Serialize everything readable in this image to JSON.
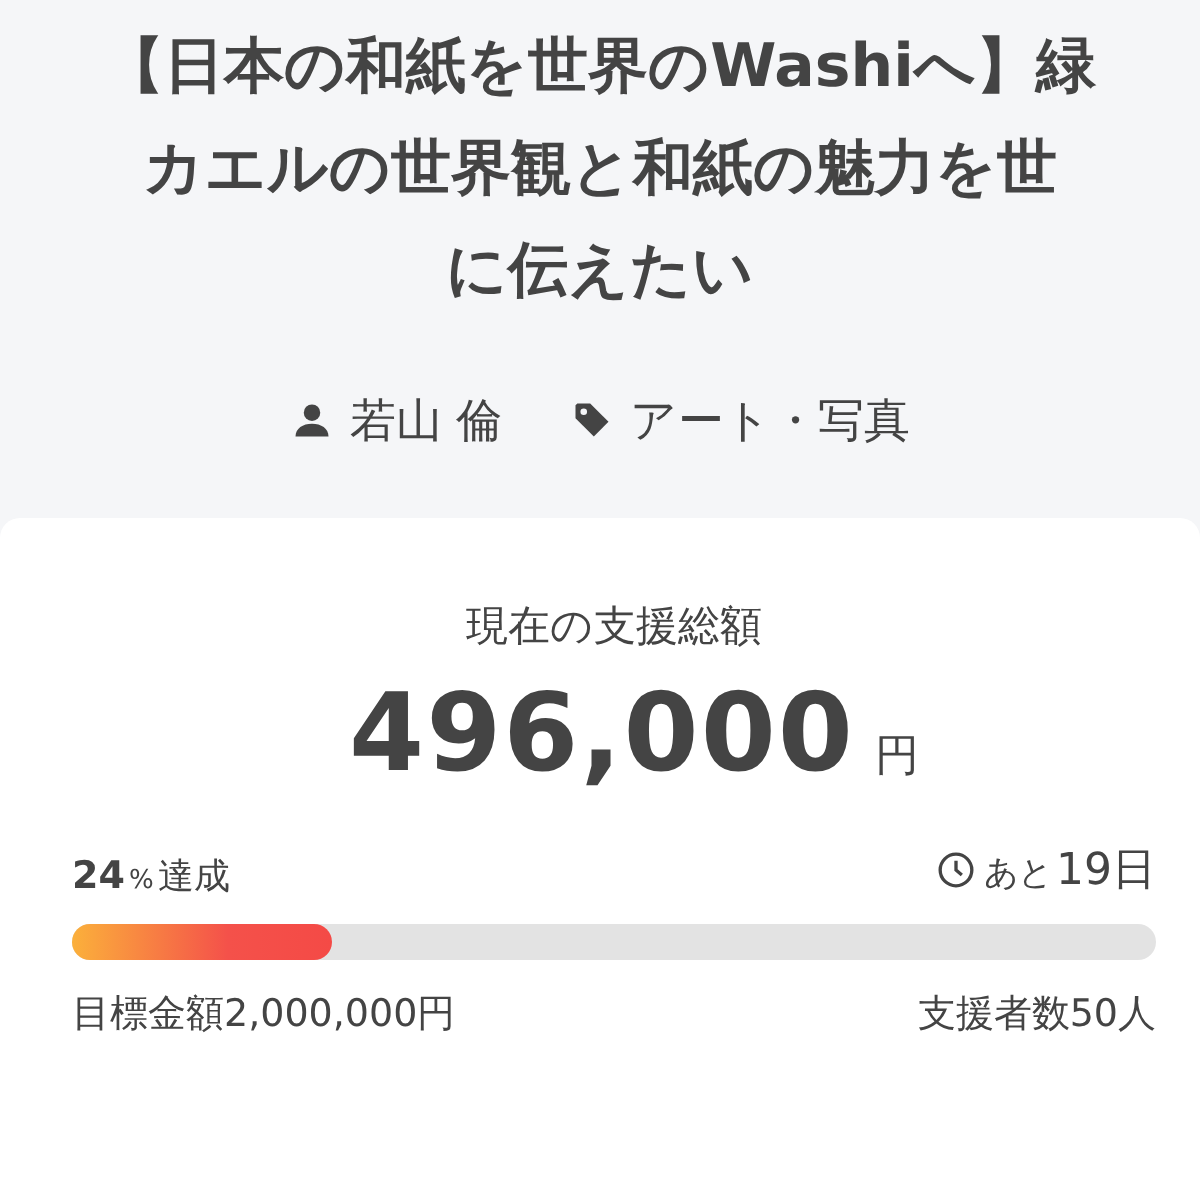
{
  "project": {
    "title_lines": [
      "【日本の和紙を世界のWashiへ】緑",
      "カエルの世界観と和紙の魅力を世",
      "に伝えたい"
    ],
    "author": "若山 倫",
    "category": "アート・写真"
  },
  "funding": {
    "heading": "現在の支援総額",
    "amount": "496,000",
    "currency": "円",
    "percent": "24",
    "percent_unit": "%",
    "percent_label": "達成",
    "remaining_prefix": "あと",
    "remaining": "19日",
    "level": 0.24,
    "goal_label": "目標金額",
    "goal": "2,000,000円",
    "backers_label": "支援者数",
    "backers": "50人"
  }
}
